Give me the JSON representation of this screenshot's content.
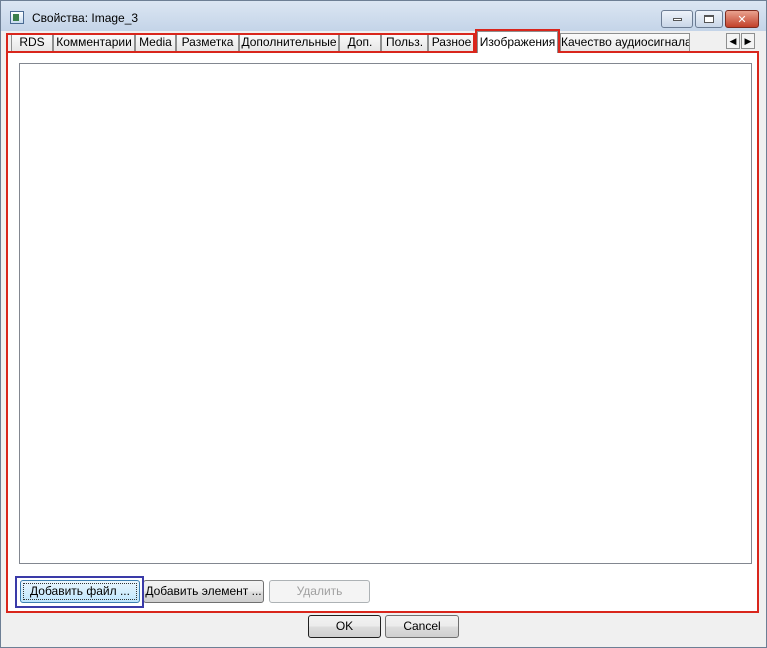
{
  "window": {
    "title": "Свойства: Image_3"
  },
  "tabs": [
    {
      "label": "RDS"
    },
    {
      "label": "Комментарии"
    },
    {
      "label": "Media"
    },
    {
      "label": "Разметка"
    },
    {
      "label": "Дополнительные"
    },
    {
      "label": "Доп."
    },
    {
      "label": "Польз."
    },
    {
      "label": "Разное"
    },
    {
      "label": "Изображения",
      "active": true
    },
    {
      "label": "Качество аудиосигнала"
    }
  ],
  "tab_scroll": {
    "left": "◀",
    "right": "▶"
  },
  "images_panel": {
    "add_file_label": "Добавить файл ...",
    "add_element_label": "Добавить элемент ...",
    "delete_label": "Удалить"
  },
  "dialog_buttons": {
    "ok_label": "OK",
    "cancel_label": "Cancel"
  },
  "colors": {
    "highlight_red": "#d9261c",
    "highlight_blue": "#3a3aa8"
  }
}
